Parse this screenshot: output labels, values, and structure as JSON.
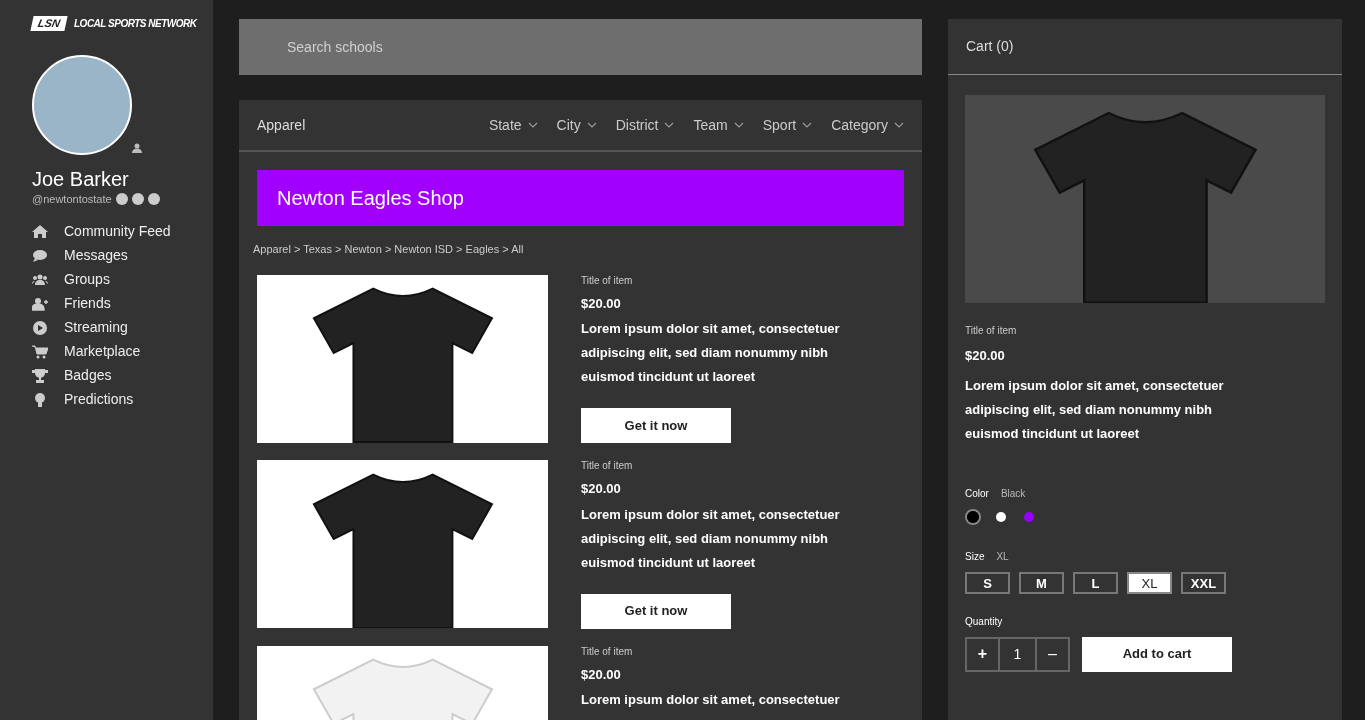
{
  "logo": {
    "badge": "LSN",
    "text": "LOCAL SPORTS NETWORK"
  },
  "user": {
    "name": "Joe Barker",
    "handle": "@newtontostate"
  },
  "nav": [
    {
      "label": "Community Feed"
    },
    {
      "label": "Messages"
    },
    {
      "label": "Groups"
    },
    {
      "label": "Friends"
    },
    {
      "label": "Streaming"
    },
    {
      "label": "Marketplace"
    },
    {
      "label": "Badges"
    },
    {
      "label": "Predictions"
    }
  ],
  "search": {
    "placeholder": "Search schools"
  },
  "shop": {
    "section": "Apparel",
    "filters": [
      "State",
      "City",
      "District",
      "Team",
      "Sport",
      "Category"
    ],
    "banner": "Newton Eagles Shop",
    "breadcrumb": "Apparel > Texas > Newton > Newton ISD > Eagles > All",
    "products": [
      {
        "title": "Title of item",
        "price": "$20.00",
        "description": "Lorem ipsum dolor sit amet, consectetuer adipiscing elit, sed diam nonummy nibh euismod tincidunt ut laoreet",
        "button": "Get it now"
      },
      {
        "title": "Title of item",
        "price": "$20.00",
        "description": "Lorem ipsum dolor sit amet, consectetuer adipiscing elit, sed diam nonummy nibh euismod tincidunt ut laoreet",
        "button": "Get it now"
      },
      {
        "title": "Title of item",
        "price": "$20.00",
        "description": "Lorem ipsum dolor sit amet, consectetuer"
      }
    ]
  },
  "cart": {
    "title": "Cart (0)",
    "item_title": "Title of item",
    "price": "$20.00",
    "description": "Lorem ipsum dolor sit amet, consectetuer adipiscing elit, sed diam nonummy nibh euismod tincidunt ut laoreet",
    "color_label": "Color",
    "color_value": "Black",
    "colors": [
      {
        "color": "#000000",
        "selected": true
      },
      {
        "color": "#ffffff",
        "selected": false
      },
      {
        "color": "#9900ff",
        "selected": false
      }
    ],
    "size_label": "Size",
    "size_value": "XL",
    "sizes": [
      {
        "label": "S",
        "selected": false
      },
      {
        "label": "M",
        "selected": false
      },
      {
        "label": "L",
        "selected": false
      },
      {
        "label": "XL",
        "selected": true
      },
      {
        "label": "XXL",
        "selected": false
      }
    ],
    "quantity_label": "Quantity",
    "plus": "+",
    "quantity": "1",
    "minus": "–",
    "add_button": "Add to cart"
  }
}
